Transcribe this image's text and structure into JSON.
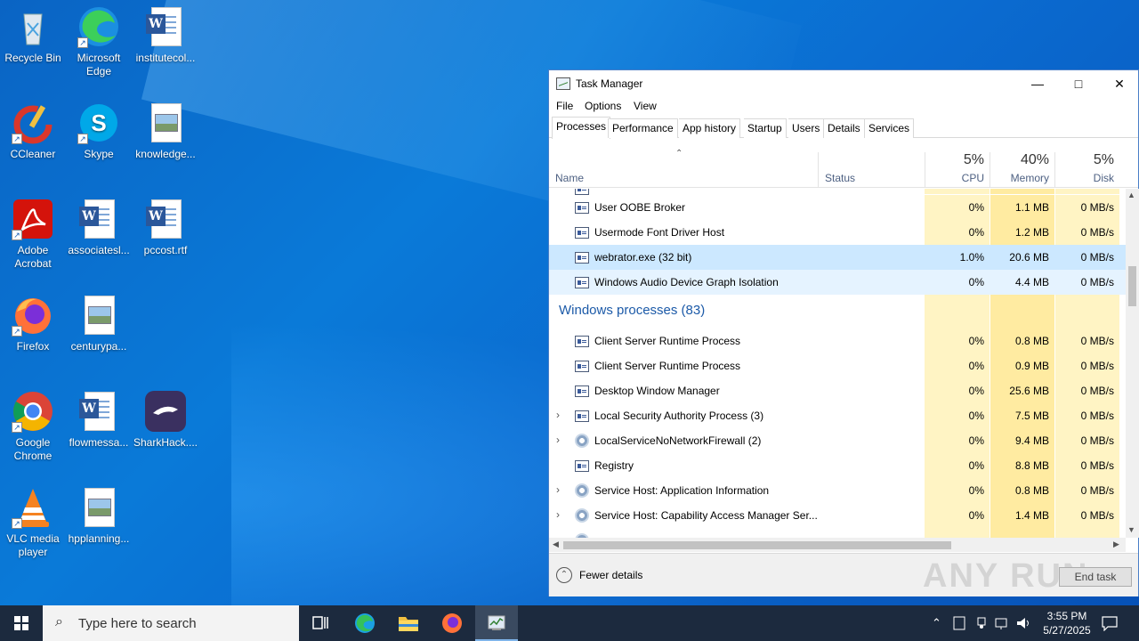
{
  "desktop": {
    "icons": [
      {
        "label": "Recycle Bin",
        "icon": "recycle-bin-icon"
      },
      {
        "label": "Microsoft Edge",
        "icon": "edge-icon"
      },
      {
        "label": "institutecol...",
        "icon": "word-doc-icon"
      },
      {
        "label": "CCleaner",
        "icon": "ccleaner-icon"
      },
      {
        "label": "Skype",
        "icon": "skype-icon"
      },
      {
        "label": "knowledge...",
        "icon": "image-file-icon"
      },
      {
        "label": "Adobe Acrobat",
        "icon": "acrobat-icon"
      },
      {
        "label": "associatesl...",
        "icon": "word-doc-icon"
      },
      {
        "label": "pccost.rtf",
        "icon": "word-doc-icon"
      },
      {
        "label": "Firefox",
        "icon": "firefox-icon"
      },
      {
        "label": "centurypa...",
        "icon": "image-file-icon"
      },
      {
        "label": "Google Chrome",
        "icon": "chrome-icon"
      },
      {
        "label": "flowmessa...",
        "icon": "word-doc-icon"
      },
      {
        "label": "SharkHack....",
        "icon": "sharkhack-icon"
      },
      {
        "label": "VLC media player",
        "icon": "vlc-icon"
      },
      {
        "label": "hpplanning...",
        "icon": "image-file-icon"
      }
    ]
  },
  "task_manager": {
    "title": "Task Manager",
    "menu": [
      "File",
      "Options",
      "View"
    ],
    "tabs": [
      "Processes",
      "Performance",
      "App history",
      "Startup",
      "Users",
      "Details",
      "Services"
    ],
    "active_tab": "Processes",
    "columns": {
      "name": "Name",
      "status": "Status",
      "cpu": {
        "pct": "5%",
        "label": "CPU"
      },
      "memory": {
        "pct": "40%",
        "label": "Memory"
      },
      "disk": {
        "pct": "5%",
        "label": "Disk"
      }
    },
    "rows": [
      {
        "name": "User OOBE Broker",
        "cpu": "0%",
        "mem": "1.1 MB",
        "disk": "0 MB/s"
      },
      {
        "name": "Usermode Font Driver Host",
        "cpu": "0%",
        "mem": "1.2 MB",
        "disk": "0 MB/s"
      },
      {
        "name": "webrator.exe (32 bit)",
        "cpu": "1.0%",
        "mem": "20.6 MB",
        "disk": "0 MB/s",
        "state": "selected"
      },
      {
        "name": "Windows Audio Device Graph Isolation",
        "cpu": "0%",
        "mem": "4.4 MB",
        "disk": "0 MB/s",
        "state": "hover"
      }
    ],
    "group_title": "Windows processes (83)",
    "windows_rows": [
      {
        "name": "Client Server Runtime Process",
        "cpu": "0%",
        "mem": "0.8 MB",
        "disk": "0 MB/s",
        "icon": "app"
      },
      {
        "name": "Client Server Runtime Process",
        "cpu": "0%",
        "mem": "0.9 MB",
        "disk": "0 MB/s",
        "icon": "app"
      },
      {
        "name": "Desktop Window Manager",
        "cpu": "0%",
        "mem": "25.6 MB",
        "disk": "0 MB/s",
        "icon": "app"
      },
      {
        "name": "Local Security Authority Process (3)",
        "cpu": "0%",
        "mem": "7.5 MB",
        "disk": "0 MB/s",
        "icon": "app",
        "expand": true
      },
      {
        "name": "LocalServiceNoNetworkFirewall (2)",
        "cpu": "0%",
        "mem": "9.4 MB",
        "disk": "0 MB/s",
        "icon": "gear",
        "expand": true
      },
      {
        "name": "Registry",
        "cpu": "0%",
        "mem": "8.8 MB",
        "disk": "0 MB/s",
        "icon": "app"
      },
      {
        "name": "Service Host: Application Information",
        "cpu": "0%",
        "mem": "0.8 MB",
        "disk": "0 MB/s",
        "icon": "gear",
        "expand": true
      },
      {
        "name": "Service Host: Capability Access Manager Ser...",
        "cpu": "0%",
        "mem": "1.4 MB",
        "disk": "0 MB/s",
        "icon": "gear",
        "expand": true
      }
    ],
    "footer": {
      "fewer_details": "Fewer details",
      "end_task": "End task"
    },
    "watermark": "ANY RUN"
  },
  "taskbar": {
    "search_placeholder": "Type here to search",
    "time": "3:55 PM",
    "date": "5/27/2025"
  }
}
